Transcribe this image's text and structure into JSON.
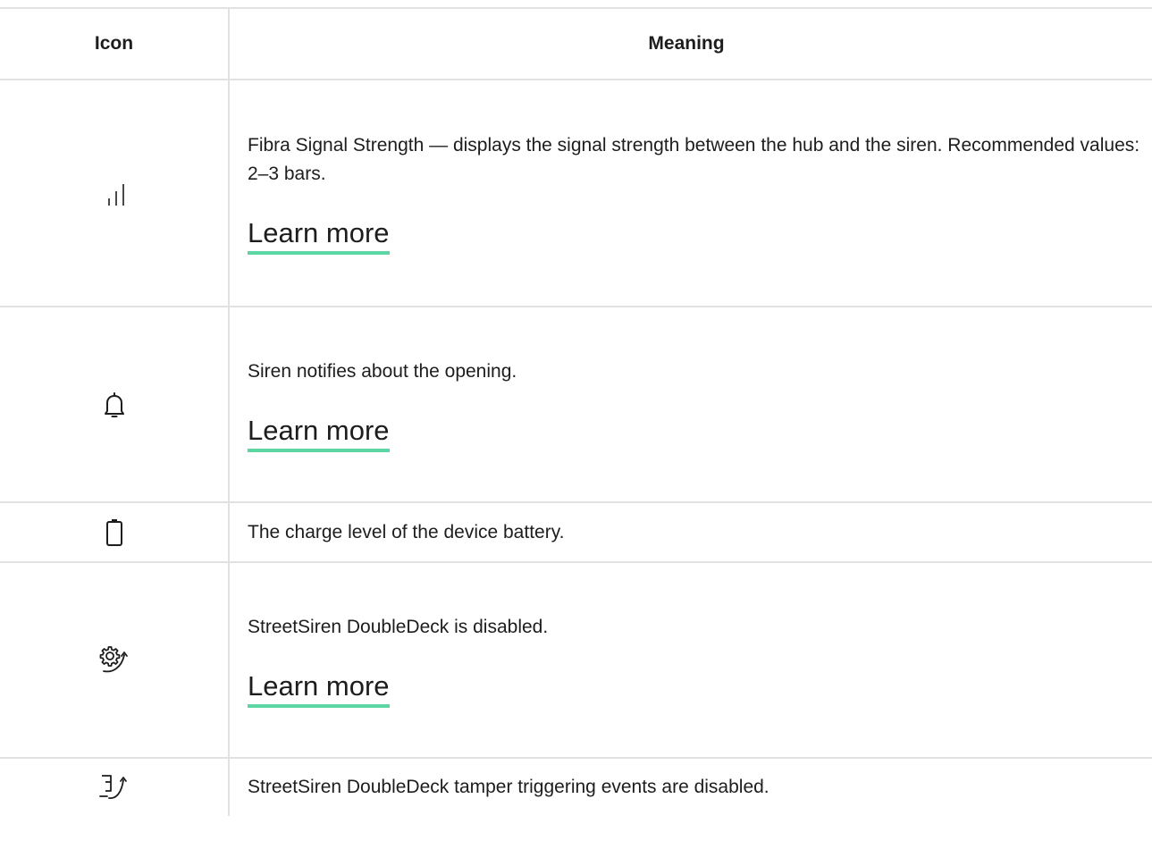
{
  "table": {
    "header": {
      "icon_col": "Icon",
      "meaning_col": "Meaning"
    },
    "rows": [
      {
        "icon": "signal-strength-icon",
        "text": "Fibra Signal Strength — displays the signal strength between the hub and the siren. Recommended values: 2–3 bars.",
        "link": "Learn more"
      },
      {
        "icon": "bell-icon",
        "text": "Siren notifies about the opening.",
        "link": "Learn more"
      },
      {
        "icon": "battery-icon",
        "text": "The charge level of the device battery."
      },
      {
        "icon": "device-disabled-icon",
        "text": "StreetSiren DoubleDeck is disabled.",
        "link": "Learn more"
      },
      {
        "icon": "tamper-disabled-icon",
        "text": "StreetSiren DoubleDeck tamper triggering events are disabled."
      }
    ]
  },
  "colors": {
    "link_underline": "#5cd6a3",
    "border": "#e1e1e1",
    "text": "#1d1d1f"
  }
}
